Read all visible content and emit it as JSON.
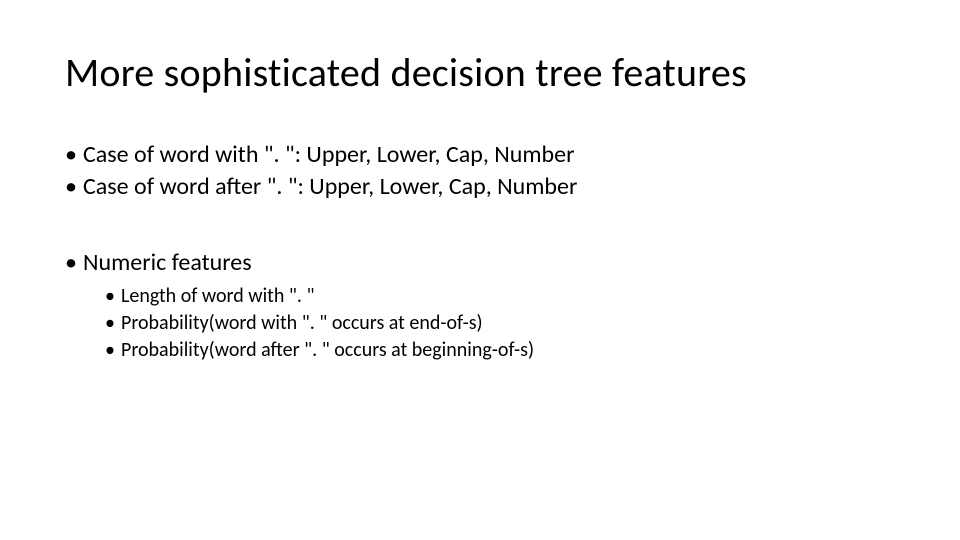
{
  "title": "More sophisticated decision tree features",
  "bullets": {
    "b1": "Case of word with \". \": Upper, Lower, Cap, Number",
    "b2": "Case of word after \". \": Upper, Lower, Cap, Number",
    "b3": "Numeric features",
    "sub": {
      "s1": "Length of word with \". \"",
      "s2": "Probability(word with \". \" occurs at end-of-s)",
      "s3": "Probability(word after \". \" occurs at beginning-of-s)"
    }
  },
  "glyphs": {
    "dot": "•"
  }
}
